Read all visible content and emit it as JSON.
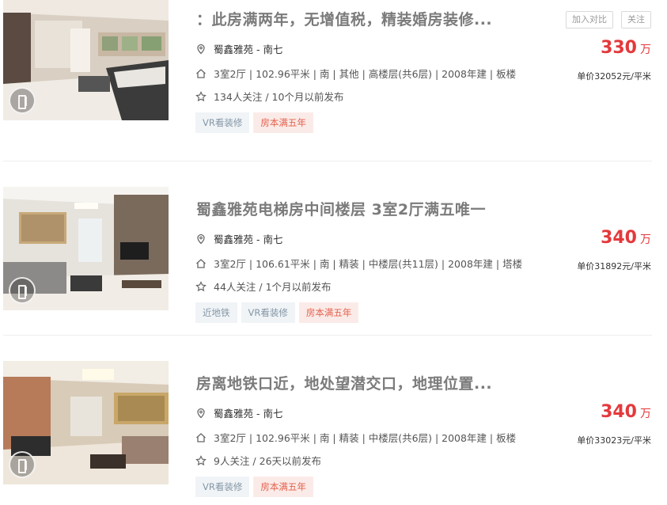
{
  "colors": {
    "price": "#e4393c",
    "tag_gray_text": "#8597a6",
    "tag_red_text": "#e4624e"
  },
  "actions": {
    "compare_label": "加入对比",
    "follow_label": "关注"
  },
  "listings": [
    {
      "title": "：此房满两年，无增值税，精装婚房装修...",
      "address": "蜀鑫雅苑 - 南七",
      "info": "3室2厅 | 102.96平米 | 南 | 其他 | 高楼层(共6层) | 2008年建 | 板楼",
      "follow": "134人关注 / 10个月以前发布",
      "tags": [
        "VR看装修",
        "房本满五年"
      ],
      "price": "330",
      "price_unit": "万",
      "unit_price": "单价32052元/平米"
    },
    {
      "title": "蜀鑫雅苑电梯房中间楼层 3室2厅满五唯一",
      "address": "蜀鑫雅苑 - 南七",
      "info": "3室2厅 | 106.61平米 | 南 | 精装 | 中楼层(共11层) | 2008年建 | 塔楼",
      "follow": "44人关注 / 1个月以前发布",
      "tags": [
        "近地铁",
        "VR看装修",
        "房本满五年"
      ],
      "price": "340",
      "price_unit": "万",
      "unit_price": "单价31892元/平米"
    },
    {
      "title": "房离地铁口近，地处望潜交口，地理位置...",
      "address": "蜀鑫雅苑 - 南七",
      "info": "3室2厅 | 102.96平米 | 南 | 精装 | 中楼层(共6层) | 2008年建 | 板楼",
      "follow": "9人关注 / 26天以前发布",
      "tags": [
        "VR看装修",
        "房本满五年"
      ],
      "price": "340",
      "price_unit": "万",
      "unit_price": "单价33023元/平米"
    }
  ]
}
